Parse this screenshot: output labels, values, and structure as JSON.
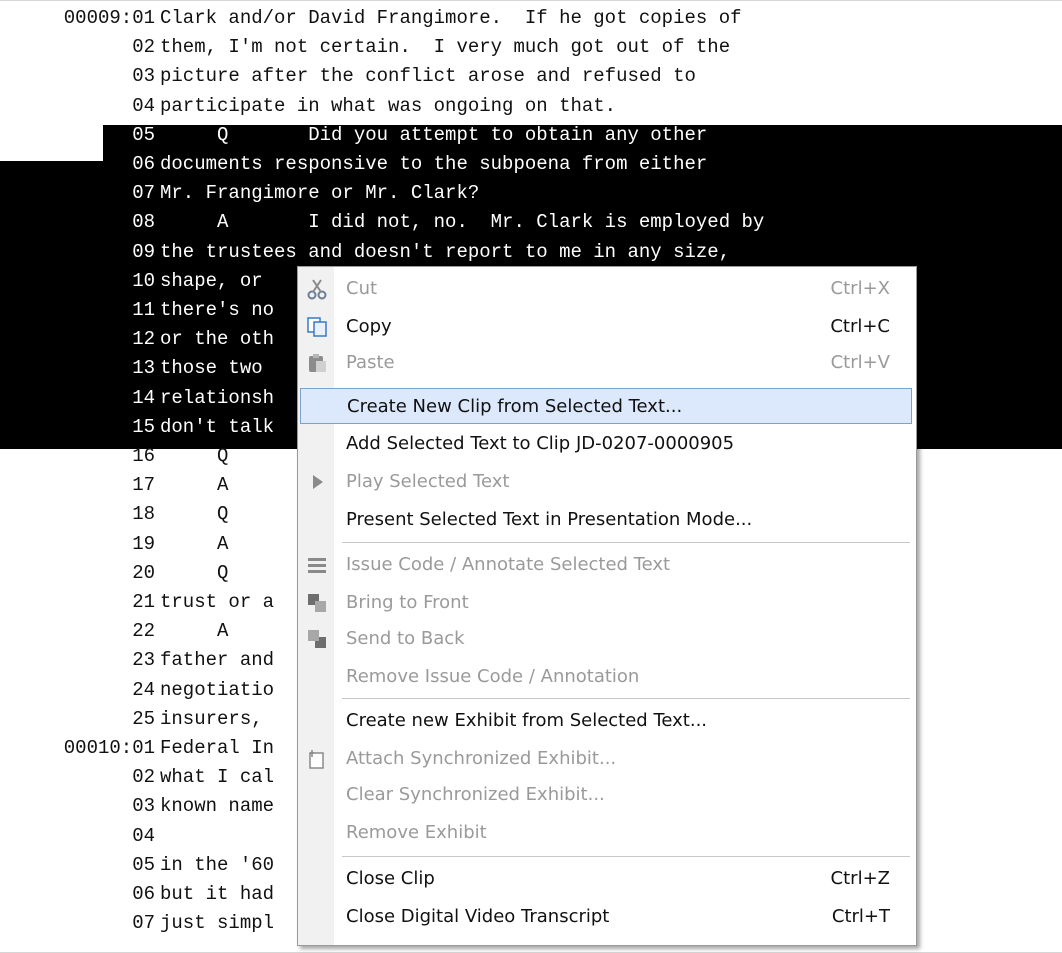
{
  "transcript": {
    "lines": [
      {
        "num": "00009:01",
        "text": "Clark and/or David Frangimore.  If he got copies of"
      },
      {
        "num": "02",
        "text": "them, I'm not certain.  I very much got out of the"
      },
      {
        "num": "03",
        "text": "picture after the conflict arose and refused to"
      },
      {
        "num": "04",
        "text": "participate in what was ongoing on that."
      },
      {
        "num": "05",
        "text": "     Q       Did you attempt to obtain any other"
      },
      {
        "num": "06",
        "text": "documents responsive to the subpoena from either"
      },
      {
        "num": "07",
        "text": "Mr. Frangimore or Mr. Clark?"
      },
      {
        "num": "08",
        "text": "     A       I did not, no.  Mr. Clark is employed by"
      },
      {
        "num": "09",
        "text": "the trustees and doesn't report to me in any size,"
      },
      {
        "num": "10",
        "text": "shape, or"
      },
      {
        "num": "11",
        "text": "there's no"
      },
      {
        "num": "12",
        "text": "or the oth"
      },
      {
        "num": "13",
        "text": "those two"
      },
      {
        "num": "14",
        "text": "relationsh"
      },
      {
        "num": "15",
        "text": "don't talk"
      },
      {
        "num": "16",
        "text": "     Q"
      },
      {
        "num": "17",
        "text": "     A"
      },
      {
        "num": "18",
        "text": "     Q"
      },
      {
        "num": "19",
        "text": "     A"
      },
      {
        "num": "20",
        "text": "     Q"
      },
      {
        "num": "21",
        "text": "trust or a"
      },
      {
        "num": "22",
        "text": "     A"
      },
      {
        "num": "23",
        "text": "father and"
      },
      {
        "num": "24",
        "text": "negotiatio"
      },
      {
        "num": "25",
        "text": "insurers,"
      },
      {
        "num": "00010:01",
        "text": "Federal In"
      },
      {
        "num": "02",
        "text": "what I cal"
      },
      {
        "num": "03",
        "text": "known name"
      },
      {
        "num": "04",
        "text": ""
      },
      {
        "num": "05",
        "text": "in the '60"
      },
      {
        "num": "06",
        "text": "but it had"
      },
      {
        "num": "07",
        "text": "just simpl"
      }
    ]
  },
  "menu": {
    "cut": {
      "label": "Cut",
      "shortcut": "Ctrl+X"
    },
    "copy": {
      "label": "Copy",
      "shortcut": "Ctrl+C"
    },
    "paste": {
      "label": "Paste",
      "shortcut": "Ctrl+V"
    },
    "create_clip": {
      "label": "Create New Clip from Selected Text..."
    },
    "add_to_clip": {
      "label": "Add Selected Text to Clip JD-0207-0000905"
    },
    "play": {
      "label": "Play Selected Text"
    },
    "present": {
      "label": "Present Selected Text in Presentation Mode..."
    },
    "issue_code": {
      "label": "Issue Code / Annotate Selected Text"
    },
    "bring_front": {
      "label": "Bring to Front"
    },
    "send_back": {
      "label": "Send to Back"
    },
    "remove_issue": {
      "label": "Remove Issue Code / Annotation"
    },
    "create_exhibit": {
      "label": "Create new Exhibit from Selected Text..."
    },
    "attach_exhibit": {
      "label": "Attach Synchronized Exhibit..."
    },
    "clear_exhibit": {
      "label": "Clear Synchronized Exhibit..."
    },
    "remove_exhibit": {
      "label": "Remove Exhibit"
    },
    "close_clip": {
      "label": "Close Clip",
      "shortcut": "Ctrl+Z"
    },
    "close_transcript": {
      "label": "Close Digital Video Transcript",
      "shortcut": "Ctrl+T"
    }
  },
  "colors": {
    "selection": "#000000",
    "menu_highlight": "#dce8fb",
    "disabled_text": "#9a9a9a"
  },
  "icons": [
    "scissors-icon",
    "copy-icon",
    "paste-icon",
    "play-icon",
    "issue-code-icon",
    "bring-to-front-icon",
    "send-to-back-icon",
    "attach-icon"
  ]
}
